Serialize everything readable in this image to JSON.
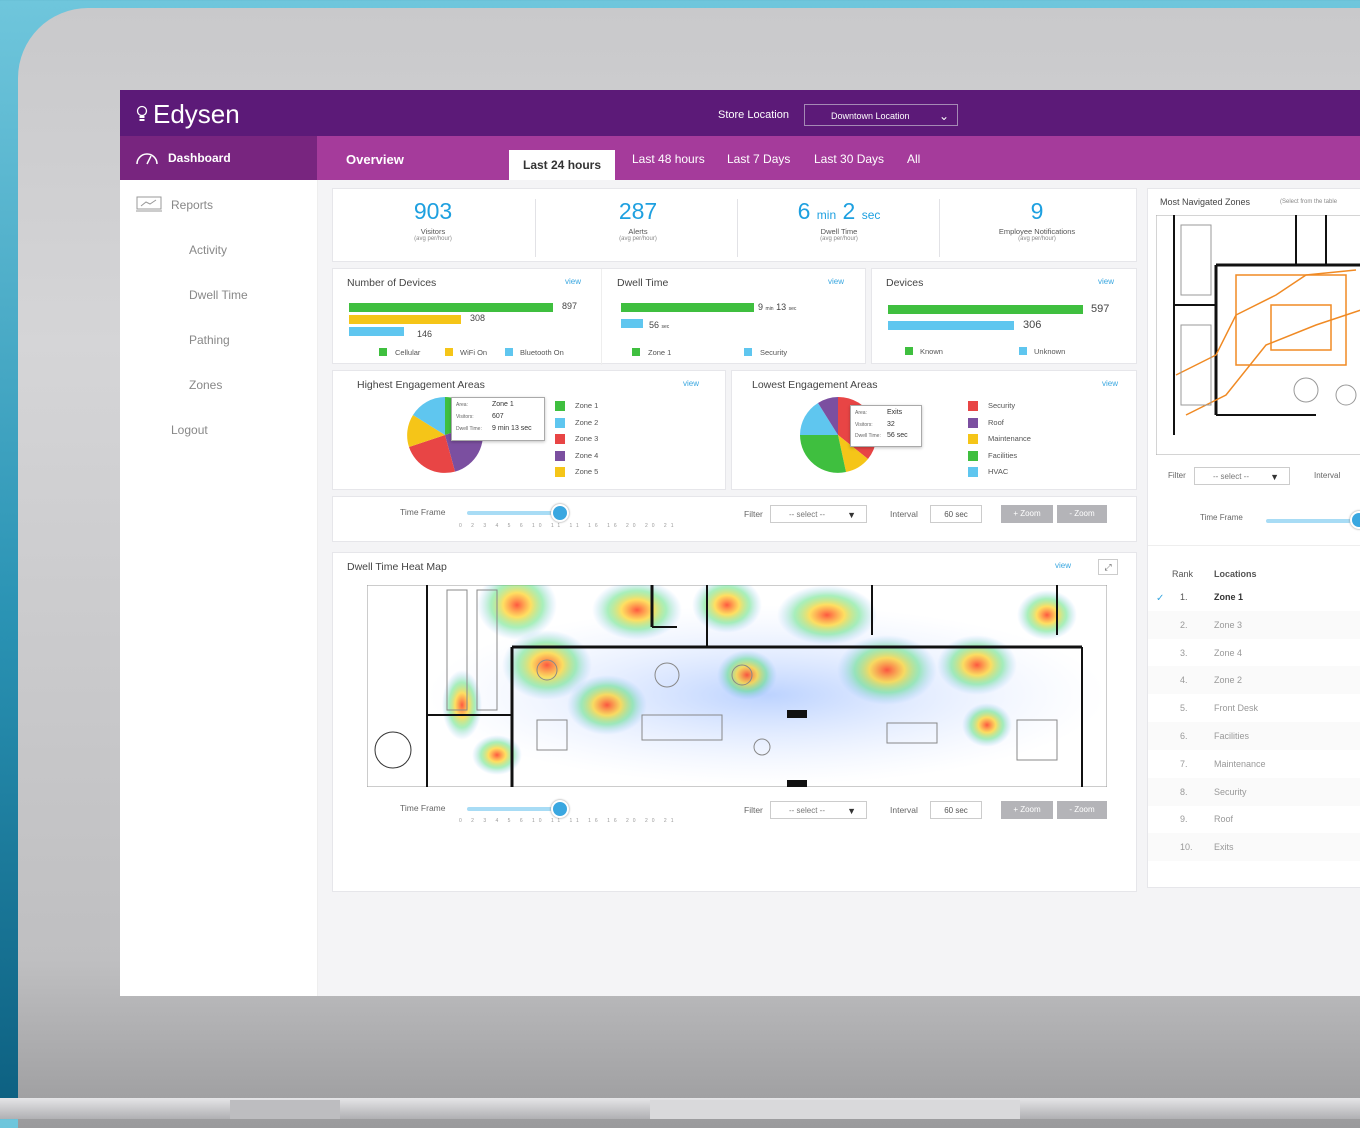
{
  "app": {
    "brand": "Edysen",
    "store_location_label": "Store Location",
    "store_location_value": "Downtown Location"
  },
  "colors": {
    "primary_purple": "#5c1a78",
    "subbar_purple": "#a53b9b",
    "accent_blue": "#1ea0e0",
    "green": "#3fbf3f",
    "yellow": "#f5c518",
    "light_blue": "#5fc6ef"
  },
  "subbar": {
    "dashboard_label": "Dashboard",
    "overview_label": "Overview",
    "tabs": [
      "Last 24 hours",
      "Last 48 hours",
      "Last 7 Days",
      "Last 30 Days",
      "All"
    ],
    "active_tab": "Last 24 hours"
  },
  "sidebar": {
    "reports_label": "Reports",
    "items": [
      "Activity",
      "Dwell Time",
      "Pathing",
      "Zones"
    ],
    "logout_label": "Logout"
  },
  "stats": [
    {
      "value": "903",
      "label": "Visitors",
      "sub": "(avg per/hour)"
    },
    {
      "value": "287",
      "label": "Alerts",
      "sub": "(avg per/hour)"
    },
    {
      "value_min": "6",
      "unit_min": "min",
      "value_sec": "2",
      "unit_sec": "sec",
      "label": "Dwell Time",
      "sub": "(avg per/hour)"
    },
    {
      "value": "9",
      "label": "Employee Notifications",
      "sub": "(avg per/hour)"
    }
  ],
  "devices_card": {
    "title": "Number of Devices",
    "view": "view",
    "bars": [
      {
        "value": "897"
      },
      {
        "value": "308"
      },
      {
        "value": "146"
      }
    ],
    "legend": [
      "Cellular",
      "WiFi On",
      "Bluetooth On"
    ]
  },
  "dwell_card": {
    "title": "Dwell Time",
    "view": "view",
    "bar1": {
      "num": "9",
      "unit1": "min",
      "num2": "13",
      "unit2": "sec"
    },
    "bar2": {
      "num": "56",
      "unit": "sec"
    },
    "legend": [
      "Zone 1",
      "Security"
    ]
  },
  "known_card": {
    "title": "Devices",
    "view": "view",
    "bars": [
      {
        "value": "597"
      },
      {
        "value": "306"
      }
    ],
    "legend": [
      "Known",
      "Unknown"
    ]
  },
  "highest_card": {
    "title": "Highest Engagement Areas",
    "view": "view",
    "tooltip": {
      "k1": "Area:",
      "v1": "Zone 1",
      "k2": "Visitors:",
      "v2": "607",
      "k3": "Dwell Time:",
      "v3": "9 min 13 sec"
    },
    "legend": [
      "Zone 1",
      "Zone 2",
      "Zone 3",
      "Zone 4",
      "Zone 5"
    ]
  },
  "lowest_card": {
    "title": "Lowest Engagement Areas",
    "view": "view",
    "tooltip": {
      "k1": "Area:",
      "v1": "Exits",
      "k2": "Visitors:",
      "v2": "32",
      "k3": "Dwell Time:",
      "v3": "56 sec"
    },
    "legend": [
      "Security",
      "Roof",
      "Maintenance",
      "Facilities",
      "HVAC"
    ]
  },
  "controls": {
    "time_frame_label": "Time Frame",
    "filter_label": "Filter",
    "select_placeholder": "-- select --",
    "interval_label": "Interval",
    "interval_value": "60 sec",
    "zoom_in": "+ Zoom",
    "zoom_out": "- Zoom",
    "ticks": "0 2 3 4 5 6 10 11 11 16 16 20 20 21"
  },
  "heatmap_card": {
    "title": "Dwell Time Heat Map",
    "view": "view"
  },
  "right_panel": {
    "title": "Most Navigated Zones",
    "hint": "(Select from the table",
    "filter_label": "Filter",
    "select_placeholder": "-- select --",
    "interval_label": "Interval",
    "time_frame_label": "Time Frame",
    "rank_header": "Rank",
    "locations_header": "Locations",
    "rows": [
      {
        "rank": "1.",
        "location": "Zone 1"
      },
      {
        "rank": "2.",
        "location": "Zone 3"
      },
      {
        "rank": "3.",
        "location": "Zone 4"
      },
      {
        "rank": "4.",
        "location": "Zone 2"
      },
      {
        "rank": "5.",
        "location": "Front Desk"
      },
      {
        "rank": "6.",
        "location": "Facilities"
      },
      {
        "rank": "7.",
        "location": "Maintenance"
      },
      {
        "rank": "8.",
        "location": "Security"
      },
      {
        "rank": "9.",
        "location": "Roof"
      },
      {
        "rank": "10.",
        "location": "Exits"
      }
    ]
  }
}
